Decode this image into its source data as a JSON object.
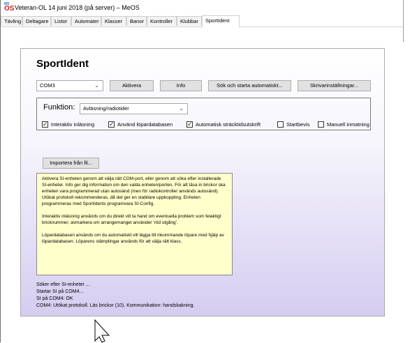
{
  "window": {
    "title": "Veteran-OL 14 juni 2018 (på server) – MeOS",
    "icon_label_top": "MS",
    "icon_label_bottom": "OS"
  },
  "tabs": [
    {
      "label": "Tävling"
    },
    {
      "label": "Deltagare"
    },
    {
      "label": "Listor"
    },
    {
      "label": "Automater"
    },
    {
      "label": "Klasser"
    },
    {
      "label": "Banor"
    },
    {
      "label": "Kontroller"
    },
    {
      "label": "Klubbar"
    },
    {
      "label": "SportIdent",
      "active": true
    }
  ],
  "main": {
    "heading": "SportIdent",
    "port_select": {
      "value": "COM3"
    },
    "buttons": {
      "activate": "Aktivera",
      "info": "Info",
      "search_auto": "Sök och starta automatiskt...",
      "printer": "Skrivarinställningar..."
    },
    "function": {
      "label": "Funktion:",
      "select_value": "Avläsning/radiotider",
      "options": [
        {
          "label": "Interaktiv inläsning",
          "checked": true
        },
        {
          "label": "Använd löpardatabasen",
          "checked": true
        },
        {
          "label": "Automatisk sträcktidsutskrift",
          "checked": true
        },
        {
          "label": "Startbevis",
          "checked": false
        },
        {
          "label": "Manuell inmatning",
          "checked": false
        }
      ]
    },
    "import_button": "Importera från fil...",
    "info_text": [
      "Aktivera SI-enheten genom att välja rätt COM-port, eller genom att söka efter installerade SI-enheter. Info ger dig information om den valda enheten/porten. För att läsa in brickor ska enheten vara programmerad utan autosänd (men för radiokontroller används autosänd). Utökat protokoll rekommenderas, då det ger en stabilare uppkoppling. Enheten programmeras med SportIdents programvara SI-Config.",
      "Interaktiv inläsning används om du direkt vill ta hand om eventuella problem som felaktigt bricknummer; avmarkera om arrangemanget använder 'röd utgång'.",
      "Löpardatabasen används om du automatiskt vill lägga till inkommande löpare med hjälp av löpardatabasen. Löparens stämplingar används för att välja rätt klass."
    ],
    "log": [
      "Söker efter SI-enheter ...",
      "Startar SI på COM4...",
      "SI på COM4: OK",
      "COM4: Utökat protokoll. Läs brickor (10). Kommunikation: handskakning."
    ]
  },
  "colors": {
    "info_bg": "#ffffcc",
    "panel_gradient_end": "#d5cdf0"
  },
  "icons": {
    "app": "meos-app-icon",
    "dropdown": "chevron-down-icon",
    "checkbox": "checkbox-icon",
    "cursor": "mouse-pointer-icon"
  }
}
